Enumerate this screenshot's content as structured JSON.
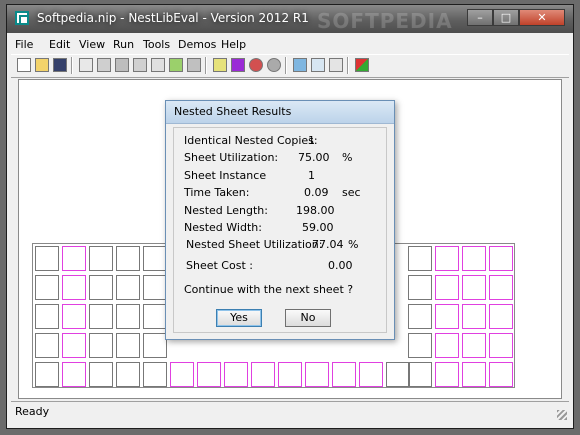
{
  "window": {
    "title": "Softpedia.nip - NestLibEval - Version 2012 R1",
    "watermark": "SOFTPEDIA",
    "min_glyph": "–",
    "max_glyph": "□",
    "close_glyph": "✕"
  },
  "menu": [
    "File",
    "Edit",
    "View",
    "Run",
    "Tools",
    "Demos",
    "Help"
  ],
  "toolbar": {
    "icons": [
      "new-icon",
      "open-icon",
      "save-icon",
      "page-icon",
      "copy-pages-icon",
      "layout-icon",
      "nest-icon",
      "sheet-icon",
      "color-part-icon",
      "settings-icon",
      "download-icon",
      "play-icon",
      "stop-icon",
      "record-icon",
      "zoom-icon",
      "tile-icon",
      "shrink-icon",
      "palette-icon"
    ]
  },
  "dialog": {
    "title": "Nested Sheet Results",
    "rows": [
      {
        "label": "Identical Nested Copies:",
        "value": "1",
        "unit": ""
      },
      {
        "label": "Sheet Utilization:",
        "value": "75.00",
        "unit": "%"
      },
      {
        "label": "Sheet Instance",
        "value": "1",
        "unit": ""
      },
      {
        "label": "Time Taken:",
        "value": "0.09",
        "unit": "sec"
      },
      {
        "label": "Nested Length:",
        "value": "198.00",
        "unit": ""
      },
      {
        "label": "Nested Width:",
        "value": "59.00",
        "unit": ""
      },
      {
        "label": "Nested Sheet Utilization:",
        "value": "77.04",
        "unit": "%"
      },
      {
        "label": "Sheet Cost :",
        "value": "0.00",
        "unit": ""
      }
    ],
    "question": "Continue with the next sheet  ?",
    "yes": "Yes",
    "no": "No"
  },
  "status": {
    "text": "Ready"
  },
  "colors": {
    "part_outline": "#e040e0",
    "grid_outline": "#777777"
  }
}
